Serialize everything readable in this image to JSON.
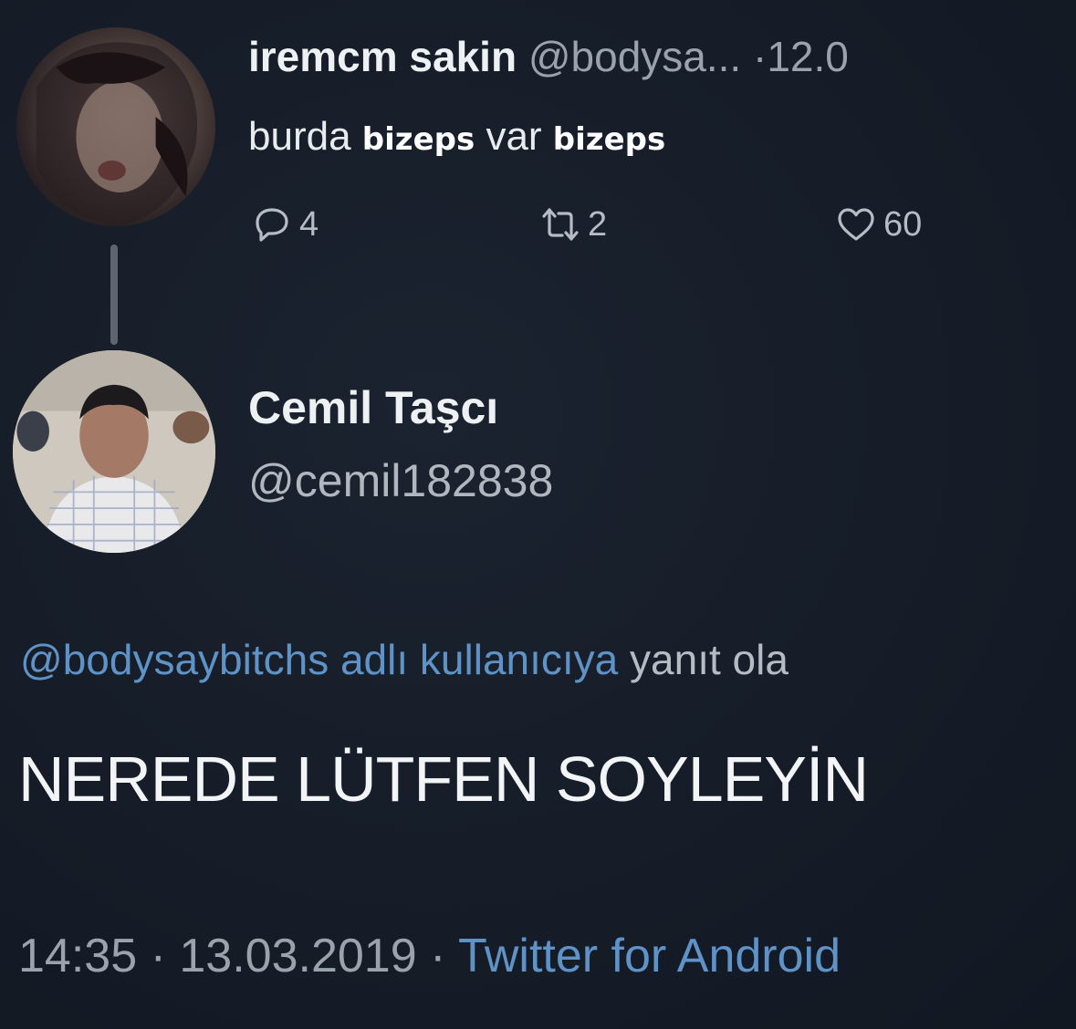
{
  "parent_tweet": {
    "display_name": "iremcm sakin",
    "handle": "@bodysa...",
    "time_separator": "·",
    "time": "12.0",
    "text_parts": [
      "burda",
      "bizeps",
      "var",
      "bizeps"
    ],
    "replies": "4",
    "retweets": "2",
    "likes": "60"
  },
  "reply_tweet": {
    "display_name": "Cemil Taşcı",
    "handle": "@cemil182838",
    "reply_to_mention": "@bodysaybitchs adlı kullanıcıya",
    "reply_to_rest": "yanıt ola",
    "text": "NEREDE LÜTFEN SOYLEYİN",
    "time": "14:35",
    "separator": "·",
    "date": "13.03.2019",
    "client": "Twitter for Android"
  },
  "colors": {
    "background": "#151c27",
    "link_blue": "#5f93c7",
    "muted_gray": "#9aa3ab"
  },
  "icons": [
    "reply-icon",
    "retweet-icon",
    "like-icon"
  ]
}
